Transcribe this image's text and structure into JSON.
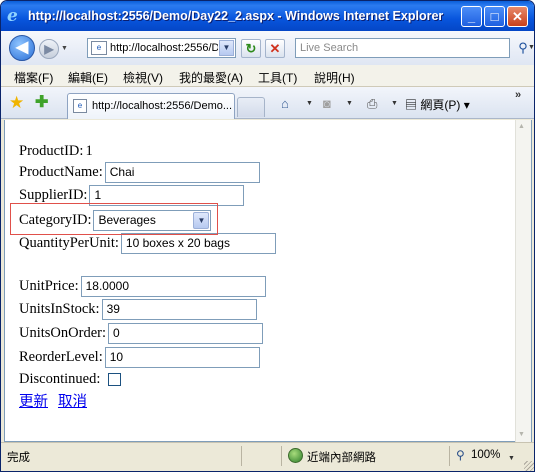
{
  "window": {
    "title": "http://localhost:2556/Demo/Day22_2.aspx - Windows Internet Explorer"
  },
  "nav": {
    "address": "http://localhost:2556/D",
    "search_placeholder": "Live Search"
  },
  "menu": [
    "檔案(F)",
    "編輯(E)",
    "檢視(V)",
    "我的最愛(A)",
    "工具(T)",
    "說明(H)"
  ],
  "tab": {
    "title": "http://localhost:2556/Demo..."
  },
  "toolbar": {
    "page_menu": "網頁(P)"
  },
  "form": {
    "product_id_label": "ProductID:",
    "product_id_value": "1",
    "product_name_label": "ProductName:",
    "product_name_value": "Chai",
    "supplier_id_label": "SupplierID:",
    "supplier_id_value": "1",
    "category_id_label": "CategoryID:",
    "category_id_value": "Beverages",
    "quantity_label": "QuantityPerUnit:",
    "quantity_value": "10 boxes x 20 bags",
    "unit_price_label": "UnitPrice:",
    "unit_price_value": "18.0000",
    "units_in_stock_label": "UnitsInStock:",
    "units_in_stock_value": "39",
    "units_on_order_label": "UnitsOnOrder:",
    "units_on_order_value": "0",
    "reorder_level_label": "ReorderLevel:",
    "reorder_level_value": "10",
    "discontinued_label": "Discontinued:",
    "discontinued_checked": false,
    "update_link": "更新",
    "cancel_link": "取消"
  },
  "status": {
    "left": "完成",
    "zone": "近端內部網路",
    "zoom": "100%"
  }
}
